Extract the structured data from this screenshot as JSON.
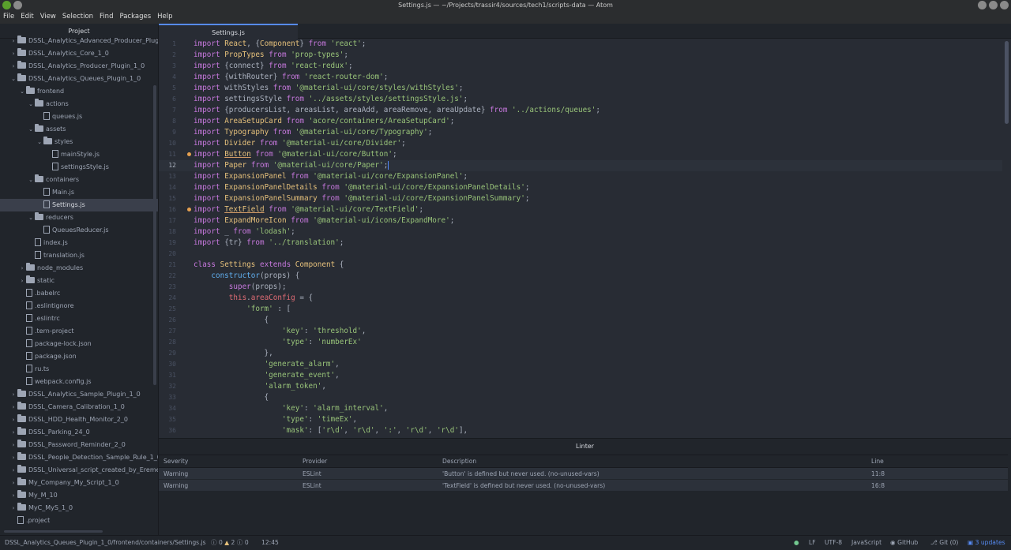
{
  "window": {
    "title": "Settings.js — ~/Projects/trassir4/sources/tech1/scripts-data — Atom"
  },
  "menu": [
    "File",
    "Edit",
    "View",
    "Selection",
    "Find",
    "Packages",
    "Help"
  ],
  "project": {
    "title": "Project",
    "items": [
      {
        "label": "DSSL_Analytics_Advanced_Producer_Plugi",
        "depth": 0,
        "type": "folder",
        "open": false
      },
      {
        "label": "DSSL_Analytics_Core_1_0",
        "depth": 0,
        "type": "folder",
        "open": false
      },
      {
        "label": "DSSL_Analytics_Producer_Plugin_1_0",
        "depth": 0,
        "type": "folder",
        "open": false
      },
      {
        "label": "DSSL_Analytics_Queues_Plugin_1_0",
        "depth": 0,
        "type": "folder",
        "open": true
      },
      {
        "label": "frontend",
        "depth": 1,
        "type": "folder",
        "open": true
      },
      {
        "label": "actions",
        "depth": 2,
        "type": "folder",
        "open": true
      },
      {
        "label": "queues.js",
        "depth": 3,
        "type": "file"
      },
      {
        "label": "assets",
        "depth": 2,
        "type": "folder",
        "open": true
      },
      {
        "label": "styles",
        "depth": 3,
        "type": "folder",
        "open": true
      },
      {
        "label": "mainStyle.js",
        "depth": 4,
        "type": "file"
      },
      {
        "label": "settingsStyle.js",
        "depth": 4,
        "type": "file"
      },
      {
        "label": "containers",
        "depth": 2,
        "type": "folder",
        "open": true
      },
      {
        "label": "Main.js",
        "depth": 3,
        "type": "file"
      },
      {
        "label": "Settings.js",
        "depth": 3,
        "type": "file",
        "selected": true
      },
      {
        "label": "reducers",
        "depth": 2,
        "type": "folder",
        "open": true
      },
      {
        "label": "QueuesReducer.js",
        "depth": 3,
        "type": "file"
      },
      {
        "label": "index.js",
        "depth": 2,
        "type": "file"
      },
      {
        "label": "translation.js",
        "depth": 2,
        "type": "file"
      },
      {
        "label": "node_modules",
        "depth": 1,
        "type": "folder",
        "open": false
      },
      {
        "label": "static",
        "depth": 1,
        "type": "folder",
        "open": false
      },
      {
        "label": ".babelrc",
        "depth": 1,
        "type": "file"
      },
      {
        "label": ".eslintignore",
        "depth": 1,
        "type": "file"
      },
      {
        "label": ".eslintrc",
        "depth": 1,
        "type": "file"
      },
      {
        "label": ".tern-project",
        "depth": 1,
        "type": "file"
      },
      {
        "label": "package-lock.json",
        "depth": 1,
        "type": "file"
      },
      {
        "label": "package.json",
        "depth": 1,
        "type": "file"
      },
      {
        "label": "ru.ts",
        "depth": 1,
        "type": "file"
      },
      {
        "label": "webpack.config.js",
        "depth": 1,
        "type": "file"
      },
      {
        "label": "DSSL_Analytics_Sample_Plugin_1_0",
        "depth": 0,
        "type": "folder",
        "open": false
      },
      {
        "label": "DSSL_Camera_Calibration_1_0",
        "depth": 0,
        "type": "folder",
        "open": false
      },
      {
        "label": "DSSL_HDD_Health_Monitor_2_0",
        "depth": 0,
        "type": "folder",
        "open": false
      },
      {
        "label": "DSSL_Parking_24_0",
        "depth": 0,
        "type": "folder",
        "open": false
      },
      {
        "label": "DSSL_Password_Reminder_2_0",
        "depth": 0,
        "type": "folder",
        "open": false
      },
      {
        "label": "DSSL_People_Detection_Sample_Rule_1_0",
        "depth": 0,
        "type": "folder",
        "open": false
      },
      {
        "label": "DSSL_Universal_script_created_by_Eremei",
        "depth": 0,
        "type": "folder",
        "open": false
      },
      {
        "label": "My_Company_My_Script_1_0",
        "depth": 0,
        "type": "folder",
        "open": false
      },
      {
        "label": "My_M_10",
        "depth": 0,
        "type": "folder",
        "open": false
      },
      {
        "label": "MyC_MyS_1_0",
        "depth": 0,
        "type": "folder",
        "open": false
      },
      {
        "label": ".project",
        "depth": 0,
        "type": "file"
      }
    ]
  },
  "tab": {
    "label": "Settings.js"
  },
  "code": {
    "current_line": 12,
    "lines": [
      {
        "n": "1",
        "html": "<span class='k'>import</span> <span class='c'>React</span>, {<span class='c'>Component</span>} <span class='k'>from</span> <span class='s'>'react'</span>;"
      },
      {
        "n": "2",
        "html": "<span class='k'>import</span> <span class='c'>PropTypes</span> <span class='k'>from</span> <span class='s'>'prop-types'</span>;"
      },
      {
        "n": "3",
        "html": "<span class='k'>import</span> {connect} <span class='k'>from</span> <span class='s'>'react-redux'</span>;"
      },
      {
        "n": "4",
        "html": "<span class='k'>import</span> {withRouter} <span class='k'>from</span> <span class='s'>'react-router-dom'</span>;"
      },
      {
        "n": "5",
        "html": "<span class='k'>import</span> withStyles <span class='k'>from</span> <span class='s'>'@material-ui/core/styles/withStyles'</span>;"
      },
      {
        "n": "6",
        "html": "<span class='k'>import</span> settingsStyle <span class='k'>from</span> <span class='s'>'../assets/styles/settingsStyle.js'</span>;"
      },
      {
        "n": "7",
        "html": "<span class='k'>import</span> {producersList, areasList, areaAdd, areaRemove, areaUpdate} <span class='k'>from</span> <span class='s'>'../actions/queues'</span>;"
      },
      {
        "n": "8",
        "html": "<span class='k'>import</span> <span class='c'>AreaSetupCard</span> <span class='k'>from</span> <span class='s'>'acore/containers/AreaSetupCard'</span>;"
      },
      {
        "n": "9",
        "html": "<span class='k'>import</span> <span class='c'>Typography</span> <span class='k'>from</span> <span class='s'>'@material-ui/core/Typography'</span>;"
      },
      {
        "n": "10",
        "html": "<span class='k'>import</span> <span class='c'>Divider</span> <span class='k'>from</span> <span class='s'>'@material-ui/core/Divider'</span>;"
      },
      {
        "n": "11",
        "mark": true,
        "html": "<span class='k'>import</span> <span class='c w'>Button</span> <span class='k'>from</span> <span class='s'>'@material-ui/core/Button'</span>;"
      },
      {
        "n": "12",
        "html": "<span class='k'>import</span> <span class='c'>Paper</span> <span class='k'>from</span> <span class='s'>'@material-ui/core/Paper'</span>;"
      },
      {
        "n": "13",
        "html": "<span class='k'>import</span> <span class='c'>ExpansionPanel</span> <span class='k'>from</span> <span class='s'>'@material-ui/core/ExpansionPanel'</span>;"
      },
      {
        "n": "14",
        "html": "<span class='k'>import</span> <span class='c'>ExpansionPanelDetails</span> <span class='k'>from</span> <span class='s'>'@material-ui/core/ExpansionPanelDetails'</span>;"
      },
      {
        "n": "15",
        "html": "<span class='k'>import</span> <span class='c'>ExpansionPanelSummary</span> <span class='k'>from</span> <span class='s'>'@material-ui/core/ExpansionPanelSummary'</span>;"
      },
      {
        "n": "16",
        "mark": true,
        "html": "<span class='k'>import</span> <span class='c w'>TextField</span> <span class='k'>from</span> <span class='s'>'@material-ui/core/TextField'</span>;"
      },
      {
        "n": "17",
        "html": "<span class='k'>import</span> <span class='c'>ExpandMoreIcon</span> <span class='k'>from</span> <span class='s'>'@material-ui/icons/ExpandMore'</span>;"
      },
      {
        "n": "18",
        "html": "<span class='k'>import</span> _ <span class='k'>from</span> <span class='s'>'lodash'</span>;"
      },
      {
        "n": "19",
        "html": "<span class='k'>import</span> {tr} <span class='k'>from</span> <span class='s'>'../translation'</span>;"
      },
      {
        "n": "20",
        "html": ""
      },
      {
        "n": "21",
        "html": "<span class='k'>class</span> <span class='c'>Settings</span> <span class='k'>extends</span> <span class='c'>Component</span> {"
      },
      {
        "n": "22",
        "html": "    <span class='f'>constructor</span>(props) {"
      },
      {
        "n": "23",
        "html": "        <span class='k'>super</span>(props);"
      },
      {
        "n": "24",
        "html": "        <span class='p'>this</span>.<span class='p'>areaConfig</span> = {"
      },
      {
        "n": "25",
        "html": "            <span class='s'>'form'</span> : ["
      },
      {
        "n": "26",
        "html": "                {"
      },
      {
        "n": "27",
        "html": "                    <span class='s'>'key'</span>: <span class='s'>'threshold'</span>,"
      },
      {
        "n": "28",
        "html": "                    <span class='s'>'type'</span>: <span class='s'>'numberEx'</span>"
      },
      {
        "n": "29",
        "html": "                },"
      },
      {
        "n": "30",
        "html": "                <span class='s'>'generate_alarm'</span>,"
      },
      {
        "n": "31",
        "html": "                <span class='s'>'generate_event'</span>,"
      },
      {
        "n": "32",
        "html": "                <span class='s'>'alarm_token'</span>,"
      },
      {
        "n": "33",
        "html": "                {"
      },
      {
        "n": "34",
        "html": "                    <span class='s'>'key'</span>: <span class='s'>'alarm_interval'</span>,"
      },
      {
        "n": "35",
        "html": "                    <span class='s'>'type'</span>: <span class='s'>'timeEx'</span>,"
      },
      {
        "n": "36",
        "html": "                    <span class='s'>'mask'</span>: [<span class='s'>'r\\d'</span>, <span class='s'>'r\\d'</span>, <span class='s'>':'</span>, <span class='s'>'r\\d'</span>, <span class='s'>'r\\d'</span>],"
      }
    ]
  },
  "linter": {
    "title": "Linter",
    "columns": [
      "Severity",
      "Provider",
      "Description",
      "Line"
    ],
    "rows": [
      {
        "severity": "Warning",
        "provider": "ESLint",
        "description": "'Button' is defined but never used. (no-unused-vars)",
        "line": "11:8"
      },
      {
        "severity": "Warning",
        "provider": "ESLint",
        "description": "'TextField' is defined but never used. (no-unused-vars)",
        "line": "16:8"
      }
    ]
  },
  "status": {
    "path": "DSSL_Analytics_Queues_Plugin_1_0/frontend/containers/Settings.js",
    "errors": "0",
    "warnings": "2",
    "infos": "0",
    "cursor": "12:45",
    "line_ending": "LF",
    "encoding": "UTF-8",
    "grammar": "JavaScript",
    "github": "GitHub",
    "git": "Git (0)",
    "updates": "3 updates"
  }
}
